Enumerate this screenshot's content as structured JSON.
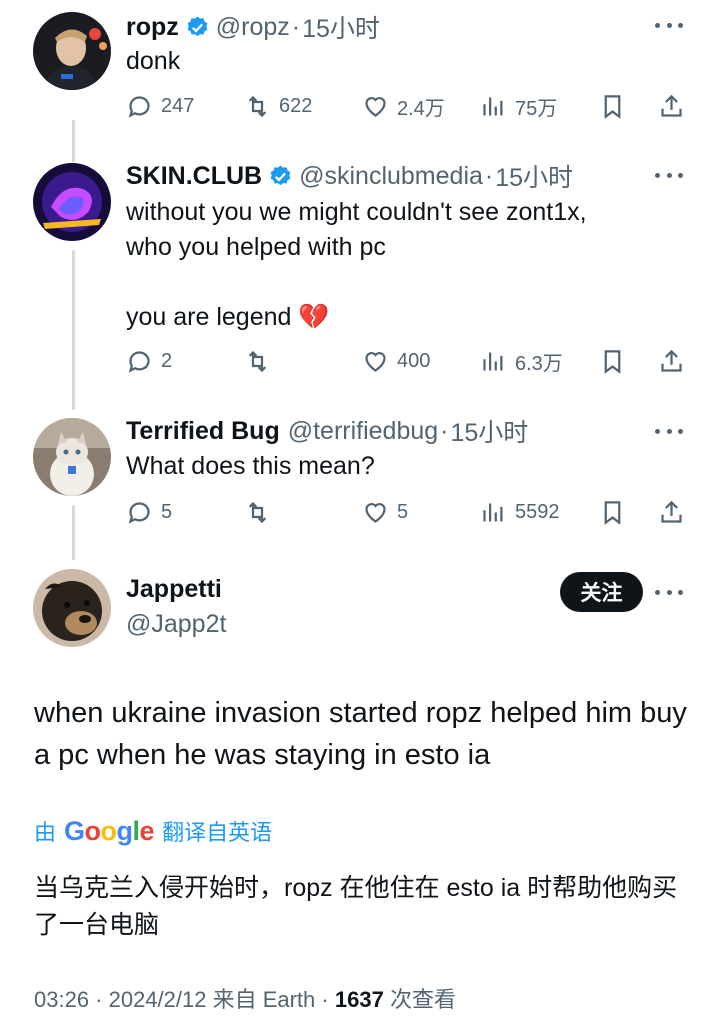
{
  "tweets": [
    {
      "name": "ropz",
      "handle": "@ropz",
      "time": "15小时",
      "verified": true,
      "text": "donk",
      "replies": "247",
      "retweets": "622",
      "likes": "2.4万",
      "views": "75万"
    },
    {
      "name": "SKIN.CLUB",
      "handle": "@skinclubmedia",
      "time": "15小时",
      "verified": true,
      "text": "without you we might couldn't see zont1x,\nwho you helped with pc\n\nyou are legend 💔",
      "replies": "2",
      "retweets": "",
      "likes": "400",
      "views": "6.3万"
    },
    {
      "name": "Terrified Bug",
      "handle": "@terrifiedbug",
      "time": "15小时",
      "verified": false,
      "text": "What does this mean?",
      "replies": "5",
      "retweets": "",
      "likes": "5",
      "views": "5592"
    }
  ],
  "main_tweet": {
    "name": "Jappetti",
    "handle": "@Japp2t",
    "follow_label": "关注",
    "text": "when ukraine invasion started ropz helped him buy a pc when he was staying in esto ia",
    "translate_prefix": "由",
    "translate_logo": "Google",
    "translate_suffix": "翻译自英语",
    "translated_text": "当乌克兰入侵开始时，ropz 在他住在 esto ia 时帮助他购买了一台电脑",
    "timestamp": "03:26 · 2024/2/12 来自 Earth ·",
    "view_count": "1637",
    "view_label": "次查看"
  },
  "colors": {
    "text": "#0f1419",
    "secondary": "#536471",
    "verified": "#1d9bf0",
    "link": "#1d9bf0",
    "thread_line": "#cfd9de"
  },
  "icons": [
    "reply-icon",
    "retweet-icon",
    "like-icon",
    "views-icon",
    "bookmark-icon",
    "share-icon",
    "more-icon",
    "verified-badge-icon"
  ]
}
